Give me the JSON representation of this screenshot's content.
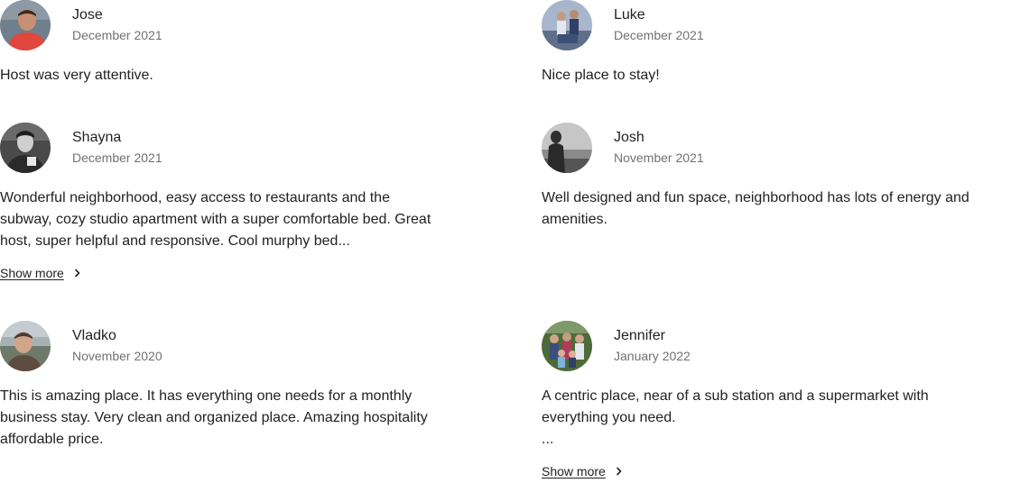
{
  "reviews": [
    {
      "name": "Jose",
      "date": "December 2021",
      "text": "Host was very attentive.",
      "avatar": "person-red-shirt-avatar",
      "avatar_colors": [
        "#7b8a9a",
        "#e0473f"
      ]
    },
    {
      "name": "Luke",
      "date": "December 2021",
      "text": "Nice place to stay!",
      "avatar": "two-people-porch-avatar",
      "avatar_colors": [
        "#8ea2c3",
        "#3c4f74"
      ]
    },
    {
      "name": "Shayna",
      "date": "December 2021",
      "text": "Wonderful neighborhood, easy access to restaurants and the\nsubway, cozy studio apartment with a super comfortable bed. Great\nhost, super helpful and responsive. Cool murphy bed...",
      "avatar": "bw-person-avatar",
      "avatar_colors": [
        "#3a3a3a",
        "#d6d6d6"
      ],
      "show_more": "Show more"
    },
    {
      "name": "Josh",
      "date": "November 2021",
      "text": "Well designed and fun space, neighborhood has lots of energy and\namenities.",
      "avatar": "bw-silhouette-avatar",
      "avatar_colors": [
        "#bdbdbd",
        "#2f2f2f"
      ]
    },
    {
      "name": "Vladko",
      "date": "November 2020",
      "text": "This is amazing place. It has everything one needs for a monthly\nbusiness stay. Very clean and organized place. Amazing hospitality\naffordable price.",
      "avatar": "outdoor-person-avatar",
      "avatar_colors": [
        "#9aa4a8",
        "#5d4c3f"
      ]
    },
    {
      "name": "Jennifer",
      "date": "January 2022",
      "text": "A centric place, near of a sub station and a supermarket with\neverything you need.\n...",
      "avatar": "family-group-avatar",
      "avatar_colors": [
        "#4d6b3a",
        "#b23a5a"
      ],
      "show_more": "Show more"
    }
  ]
}
